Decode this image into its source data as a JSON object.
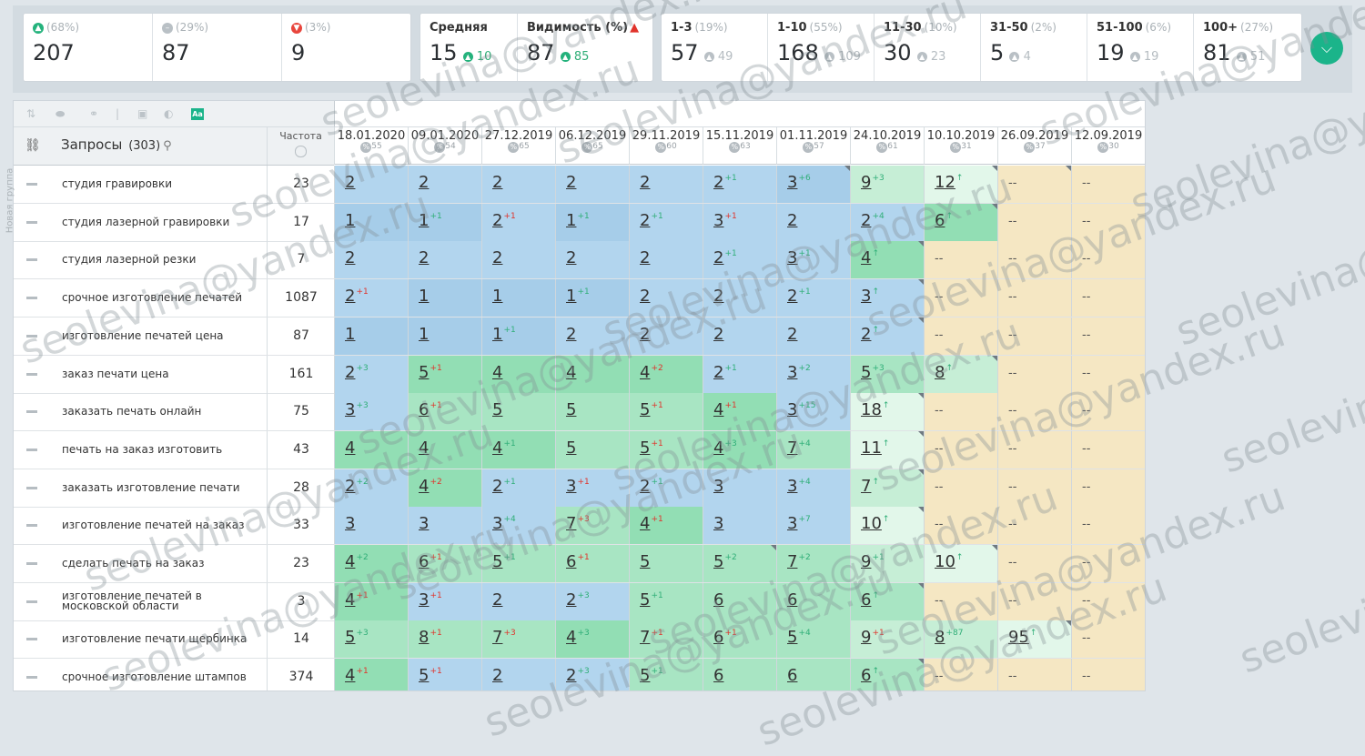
{
  "summary": {
    "up": {
      "pct": "(68%)",
      "value": "207"
    },
    "same": {
      "pct": "(29%)",
      "value": "87"
    },
    "down": {
      "pct": "(3%)",
      "value": "9"
    }
  },
  "avg": {
    "label": "Средняя",
    "value": "15",
    "delta": "10"
  },
  "visibility": {
    "label": "Видимость (%)",
    "value": "87",
    "delta": "85"
  },
  "ranges": [
    {
      "label": "1-3",
      "pct": "(19%)",
      "value": "57",
      "delta": "49"
    },
    {
      "label": "1-10",
      "pct": "(55%)",
      "value": "168",
      "delta": "109"
    },
    {
      "label": "11-30",
      "pct": "(10%)",
      "value": "30",
      "delta": "23"
    },
    {
      "label": "31-50",
      "pct": "(2%)",
      "value": "5",
      "delta": "4"
    },
    {
      "label": "51-100",
      "pct": "(6%)",
      "value": "19",
      "delta": "19"
    },
    {
      "label": "100+",
      "pct": "(27%)",
      "value": "81",
      "delta": "51"
    }
  ],
  "table": {
    "queries_label": "Запросы",
    "queries_count": "(303)",
    "freq_label": "Частота",
    "group_label": "Новая группа",
    "dates": [
      {
        "date": "18.01.2020",
        "sub": "55"
      },
      {
        "date": "09.01.2020",
        "sub": "54"
      },
      {
        "date": "27.12.2019",
        "sub": "65"
      },
      {
        "date": "06.12.2019",
        "sub": "65"
      },
      {
        "date": "29.11.2019",
        "sub": "60"
      },
      {
        "date": "15.11.2019",
        "sub": "63"
      },
      {
        "date": "01.11.2019",
        "sub": "57"
      },
      {
        "date": "24.10.2019",
        "sub": "61"
      },
      {
        "date": "10.10.2019",
        "sub": "31"
      },
      {
        "date": "26.09.2019",
        "sub": "37"
      },
      {
        "date": "12.09.2019",
        "sub": "30"
      }
    ],
    "rows": [
      {
        "q": "студия гравировки",
        "f": "23",
        "cells": [
          [
            "2",
            "",
            "",
            "c2"
          ],
          [
            "2",
            "",
            "",
            "c2"
          ],
          [
            "2",
            "",
            "",
            "c2"
          ],
          [
            "2",
            "",
            "",
            "c2"
          ],
          [
            "2",
            "",
            "",
            "c2"
          ],
          [
            "2",
            "+1",
            "up",
            "c2"
          ],
          [
            "3",
            "+6",
            "up",
            "c1",
            1
          ],
          [
            "9",
            "+3",
            "up",
            "c5"
          ],
          [
            "12",
            "↑",
            "up",
            "c6",
            1
          ],
          [
            "--",
            "",
            "",
            "c0",
            1
          ],
          [
            "--",
            "",
            "",
            "c0"
          ]
        ]
      },
      {
        "q": "студия лазерной гравировки",
        "f": "17",
        "cells": [
          [
            "1",
            "",
            "",
            "c1"
          ],
          [
            "1",
            "+1",
            "up",
            "c1"
          ],
          [
            "2",
            "+1",
            "dn",
            "c2"
          ],
          [
            "1",
            "+1",
            "up",
            "c1"
          ],
          [
            "2",
            "+1",
            "up",
            "c2"
          ],
          [
            "3",
            "+1",
            "dn",
            "c2"
          ],
          [
            "2",
            "",
            "",
            "c2"
          ],
          [
            "2",
            "+4",
            "up",
            "c2"
          ],
          [
            "6",
            "↑",
            "up",
            "c3",
            1
          ],
          [
            "--",
            "",
            "",
            "c0"
          ],
          [
            "--",
            "",
            "",
            "c0"
          ]
        ]
      },
      {
        "q": "студия лазерной резки",
        "f": "7",
        "cells": [
          [
            "2",
            "",
            "",
            "c2"
          ],
          [
            "2",
            "",
            "",
            "c2"
          ],
          [
            "2",
            "",
            "",
            "c2"
          ],
          [
            "2",
            "",
            "",
            "c2"
          ],
          [
            "2",
            "",
            "",
            "c2"
          ],
          [
            "2",
            "+1",
            "up",
            "c2"
          ],
          [
            "3",
            "+1",
            "up",
            "c2"
          ],
          [
            "4",
            "↑",
            "up",
            "c3",
            1
          ],
          [
            "--",
            "",
            "",
            "c0"
          ],
          [
            "--",
            "",
            "",
            "c0"
          ],
          [
            "--",
            "",
            "",
            "c0"
          ]
        ]
      },
      {
        "q": "срочное изготовление печатей",
        "f": "1087",
        "cells": [
          [
            "2",
            "+1",
            "dn",
            "c2"
          ],
          [
            "1",
            "",
            "",
            "c1"
          ],
          [
            "1",
            "",
            "",
            "c1"
          ],
          [
            "1",
            "+1",
            "up",
            "c1"
          ],
          [
            "2",
            "",
            "",
            "c2"
          ],
          [
            "2",
            "",
            "",
            "c2"
          ],
          [
            "2",
            "+1",
            "up",
            "c2"
          ],
          [
            "3",
            "↑",
            "up",
            "c2",
            1
          ],
          [
            "--",
            "",
            "",
            "c0"
          ],
          [
            "--",
            "",
            "",
            "c0"
          ],
          [
            "--",
            "",
            "",
            "c0"
          ]
        ]
      },
      {
        "q": "изготовление печатей цена",
        "f": "87",
        "cells": [
          [
            "1",
            "",
            "",
            "c1"
          ],
          [
            "1",
            "",
            "",
            "c1"
          ],
          [
            "1",
            "+1",
            "up",
            "c1"
          ],
          [
            "2",
            "",
            "",
            "c2"
          ],
          [
            "2",
            "",
            "",
            "c2"
          ],
          [
            "2",
            "",
            "",
            "c2"
          ],
          [
            "2",
            "",
            "",
            "c2"
          ],
          [
            "2",
            "↑",
            "up",
            "c2",
            1
          ],
          [
            "--",
            "",
            "",
            "c0"
          ],
          [
            "--",
            "",
            "",
            "c0"
          ],
          [
            "--",
            "",
            "",
            "c0"
          ]
        ]
      },
      {
        "q": "заказ печати цена",
        "f": "161",
        "cells": [
          [
            "2",
            "+3",
            "up",
            "c2"
          ],
          [
            "5",
            "+1",
            "dn",
            "c3"
          ],
          [
            "4",
            "",
            "",
            "c3"
          ],
          [
            "4",
            "",
            "",
            "c3"
          ],
          [
            "4",
            "+2",
            "dn",
            "c3"
          ],
          [
            "2",
            "+1",
            "up",
            "c2"
          ],
          [
            "3",
            "+2",
            "up",
            "c2"
          ],
          [
            "5",
            "+3",
            "up",
            "c4"
          ],
          [
            "8",
            "↑",
            "up",
            "c5",
            1
          ],
          [
            "--",
            "",
            "",
            "c0"
          ],
          [
            "--",
            "",
            "",
            "c0"
          ]
        ]
      },
      {
        "q": "заказать печать онлайн",
        "f": "75",
        "cells": [
          [
            "3",
            "+3",
            "up",
            "c2"
          ],
          [
            "6",
            "+1",
            "dn",
            "c4"
          ],
          [
            "5",
            "",
            "",
            "c4"
          ],
          [
            "5",
            "",
            "",
            "c4"
          ],
          [
            "5",
            "+1",
            "dn",
            "c4"
          ],
          [
            "4",
            "+1",
            "dn",
            "c3"
          ],
          [
            "3",
            "+15",
            "up",
            "c2"
          ],
          [
            "18",
            "↑",
            "up",
            "c6",
            1
          ],
          [
            "--",
            "",
            "",
            "c0"
          ],
          [
            "--",
            "",
            "",
            "c0"
          ],
          [
            "--",
            "",
            "",
            "c0"
          ]
        ]
      },
      {
        "q": "печать на заказ изготовить",
        "f": "43",
        "cells": [
          [
            "4",
            "",
            "",
            "c3"
          ],
          [
            "4",
            "",
            "",
            "c3"
          ],
          [
            "4",
            "+1",
            "up",
            "c3"
          ],
          [
            "5",
            "",
            "",
            "c4"
          ],
          [
            "5",
            "+1",
            "dn",
            "c4"
          ],
          [
            "4",
            "+3",
            "up",
            "c3"
          ],
          [
            "7",
            "+4",
            "up",
            "c4"
          ],
          [
            "11",
            "↑",
            "up",
            "c6",
            1
          ],
          [
            "--",
            "",
            "",
            "c0"
          ],
          [
            "--",
            "",
            "",
            "c0"
          ],
          [
            "--",
            "",
            "",
            "c0"
          ]
        ]
      },
      {
        "q": "заказать изготовление печати",
        "f": "28",
        "cells": [
          [
            "2",
            "+2",
            "up",
            "c2"
          ],
          [
            "4",
            "+2",
            "dn",
            "c3"
          ],
          [
            "2",
            "+1",
            "up",
            "c2"
          ],
          [
            "3",
            "+1",
            "dn",
            "c2"
          ],
          [
            "2",
            "+1",
            "up",
            "c2"
          ],
          [
            "3",
            "",
            "",
            "c2"
          ],
          [
            "3",
            "+4",
            "up",
            "c2"
          ],
          [
            "7",
            "↑",
            "up",
            "c5",
            1
          ],
          [
            "--",
            "",
            "",
            "c0"
          ],
          [
            "--",
            "",
            "",
            "c0"
          ],
          [
            "--",
            "",
            "",
            "c0"
          ]
        ]
      },
      {
        "q": "изготовление печатей на заказ",
        "f": "33",
        "cells": [
          [
            "3",
            "",
            "",
            "c2"
          ],
          [
            "3",
            "",
            "",
            "c2"
          ],
          [
            "3",
            "+4",
            "up",
            "c2"
          ],
          [
            "7",
            "+3",
            "dn",
            "c4"
          ],
          [
            "4",
            "+1",
            "dn",
            "c3"
          ],
          [
            "3",
            "",
            "",
            "c2"
          ],
          [
            "3",
            "+7",
            "up",
            "c2"
          ],
          [
            "10",
            "↑",
            "up",
            "c6",
            1
          ],
          [
            "--",
            "",
            "",
            "c0"
          ],
          [
            "--",
            "",
            "",
            "c0"
          ],
          [
            "--",
            "",
            "",
            "c0"
          ]
        ]
      },
      {
        "q": "сделать печать на заказ",
        "f": "23",
        "cells": [
          [
            "4",
            "+2",
            "up",
            "c3"
          ],
          [
            "6",
            "+1",
            "dn",
            "c4"
          ],
          [
            "5",
            "+1",
            "up",
            "c4"
          ],
          [
            "6",
            "+1",
            "dn",
            "c4"
          ],
          [
            "5",
            "",
            "",
            "c4"
          ],
          [
            "5",
            "+2",
            "up",
            "c4",
            1
          ],
          [
            "7",
            "+2",
            "up",
            "c4"
          ],
          [
            "9",
            "+1",
            "up",
            "c5"
          ],
          [
            "10",
            "↑",
            "up",
            "c6",
            1
          ],
          [
            "--",
            "",
            "",
            "c0"
          ],
          [
            "--",
            "",
            "",
            "c0"
          ]
        ]
      },
      {
        "q": "изготовление печатей в московской области",
        "f": "3",
        "cells": [
          [
            "4",
            "+1",
            "dn",
            "c3"
          ],
          [
            "3",
            "+1",
            "dn",
            "c2"
          ],
          [
            "2",
            "",
            "",
            "c2"
          ],
          [
            "2",
            "+3",
            "up",
            "c2"
          ],
          [
            "5",
            "+1",
            "up",
            "c4"
          ],
          [
            "6",
            "",
            "",
            "c4"
          ],
          [
            "6",
            "",
            "",
            "c4"
          ],
          [
            "6",
            "↑",
            "up",
            "c4",
            1
          ],
          [
            "--",
            "",
            "",
            "c0"
          ],
          [
            "--",
            "",
            "",
            "c0"
          ],
          [
            "--",
            "",
            "",
            "c0"
          ]
        ]
      },
      {
        "q": "изготовление печати щербинка",
        "f": "14",
        "cells": [
          [
            "5",
            "+3",
            "up",
            "c4"
          ],
          [
            "8",
            "+1",
            "dn",
            "c4"
          ],
          [
            "7",
            "+3",
            "dn",
            "c4"
          ],
          [
            "4",
            "+3",
            "up",
            "c3"
          ],
          [
            "7",
            "+1",
            "dn",
            "c4"
          ],
          [
            "6",
            "+1",
            "dn",
            "c4"
          ],
          [
            "5",
            "+4",
            "up",
            "c4"
          ],
          [
            "9",
            "+1",
            "dn",
            "c5"
          ],
          [
            "8",
            "+87",
            "up",
            "c5"
          ],
          [
            "95",
            "↑",
            "up",
            "c6",
            1
          ],
          [
            "--",
            "",
            "",
            "c0"
          ]
        ]
      },
      {
        "q": "срочное изготовление штампов",
        "f": "374",
        "cells": [
          [
            "4",
            "+1",
            "dn",
            "c3"
          ],
          [
            "5",
            "+1",
            "dn",
            "c2"
          ],
          [
            "2",
            "",
            "",
            "c2"
          ],
          [
            "2",
            "+3",
            "up",
            "c2"
          ],
          [
            "5",
            "+1",
            "up",
            "c4"
          ],
          [
            "6",
            "",
            "",
            "c4"
          ],
          [
            "6",
            "",
            "",
            "c4"
          ],
          [
            "6",
            "↑",
            "up",
            "c4",
            1
          ],
          [
            "--",
            "",
            "",
            "c0"
          ],
          [
            "--",
            "",
            "",
            "c0"
          ],
          [
            "--",
            "",
            "",
            "c0"
          ]
        ]
      }
    ]
  },
  "watermark": "seolevina@yandex.ru"
}
